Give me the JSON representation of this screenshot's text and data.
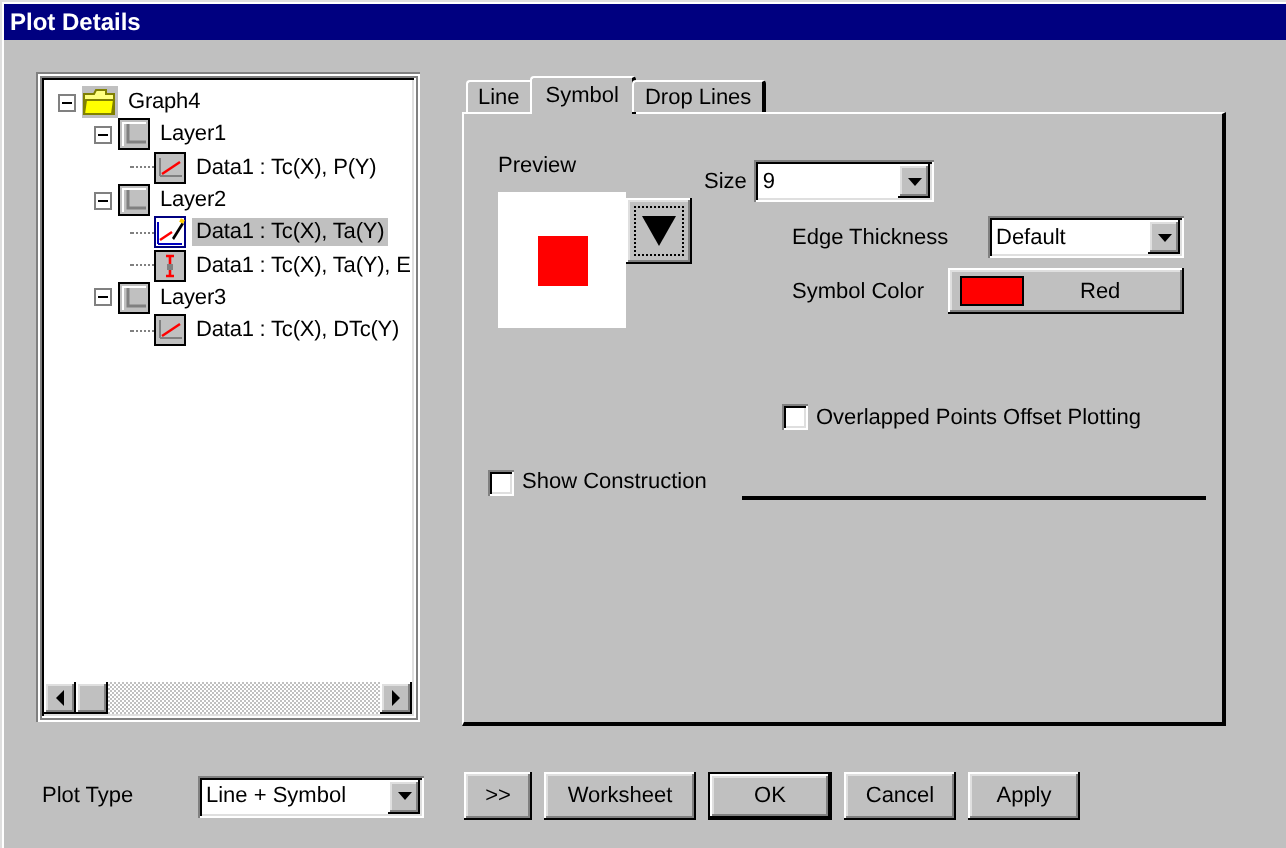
{
  "window": {
    "title": "Plot Details"
  },
  "tree": [
    {
      "label": "Graph4",
      "kind": "folder",
      "expanded": true,
      "selected": false,
      "children": [
        {
          "label": "Layer1",
          "kind": "layer",
          "expanded": true,
          "selected": false,
          "children": [
            {
              "label": "Data1 : Tc(X), P(Y)",
              "kind": "line-plot",
              "selected": false
            }
          ]
        },
        {
          "label": "Layer2",
          "kind": "layer",
          "expanded": true,
          "selected": false,
          "children": [
            {
              "label": "Data1 : Tc(X), Ta(Y)",
              "kind": "edit-plot",
              "selected": true
            },
            {
              "label": "Data1 : Tc(X), Ta(Y), E",
              "kind": "error-plot",
              "selected": false
            }
          ]
        },
        {
          "label": "Layer3",
          "kind": "layer",
          "expanded": true,
          "selected": false,
          "children": [
            {
              "label": "Data1 : Tc(X), DTc(Y)",
              "kind": "line-plot",
              "selected": false
            }
          ]
        }
      ]
    }
  ],
  "tabs": [
    {
      "label": "Line",
      "selected": false
    },
    {
      "label": "Symbol",
      "selected": true
    },
    {
      "label": "Drop Lines",
      "selected": false
    }
  ],
  "symbol": {
    "preview_label": "Preview",
    "size": {
      "label": "Size",
      "value": "9"
    },
    "edge_thickness": {
      "label": "Edge Thickness",
      "value": "Default"
    },
    "symbol_color": {
      "label": "Symbol Color",
      "value": "Red",
      "color": "#ff0000"
    },
    "overlapped_offset": {
      "label": "Overlapped Points Offset Plotting",
      "checked": false
    },
    "show_construction": {
      "label": "Show Construction",
      "checked": false
    }
  },
  "plot_type": {
    "label": "Plot Type",
    "value": "Line + Symbol"
  },
  "buttons": [
    {
      "label": ">>",
      "default": false
    },
    {
      "label": "Worksheet",
      "default": false
    },
    {
      "label": "OK",
      "default": true
    },
    {
      "label": "Cancel",
      "default": false
    },
    {
      "label": "Apply",
      "default": false
    }
  ]
}
